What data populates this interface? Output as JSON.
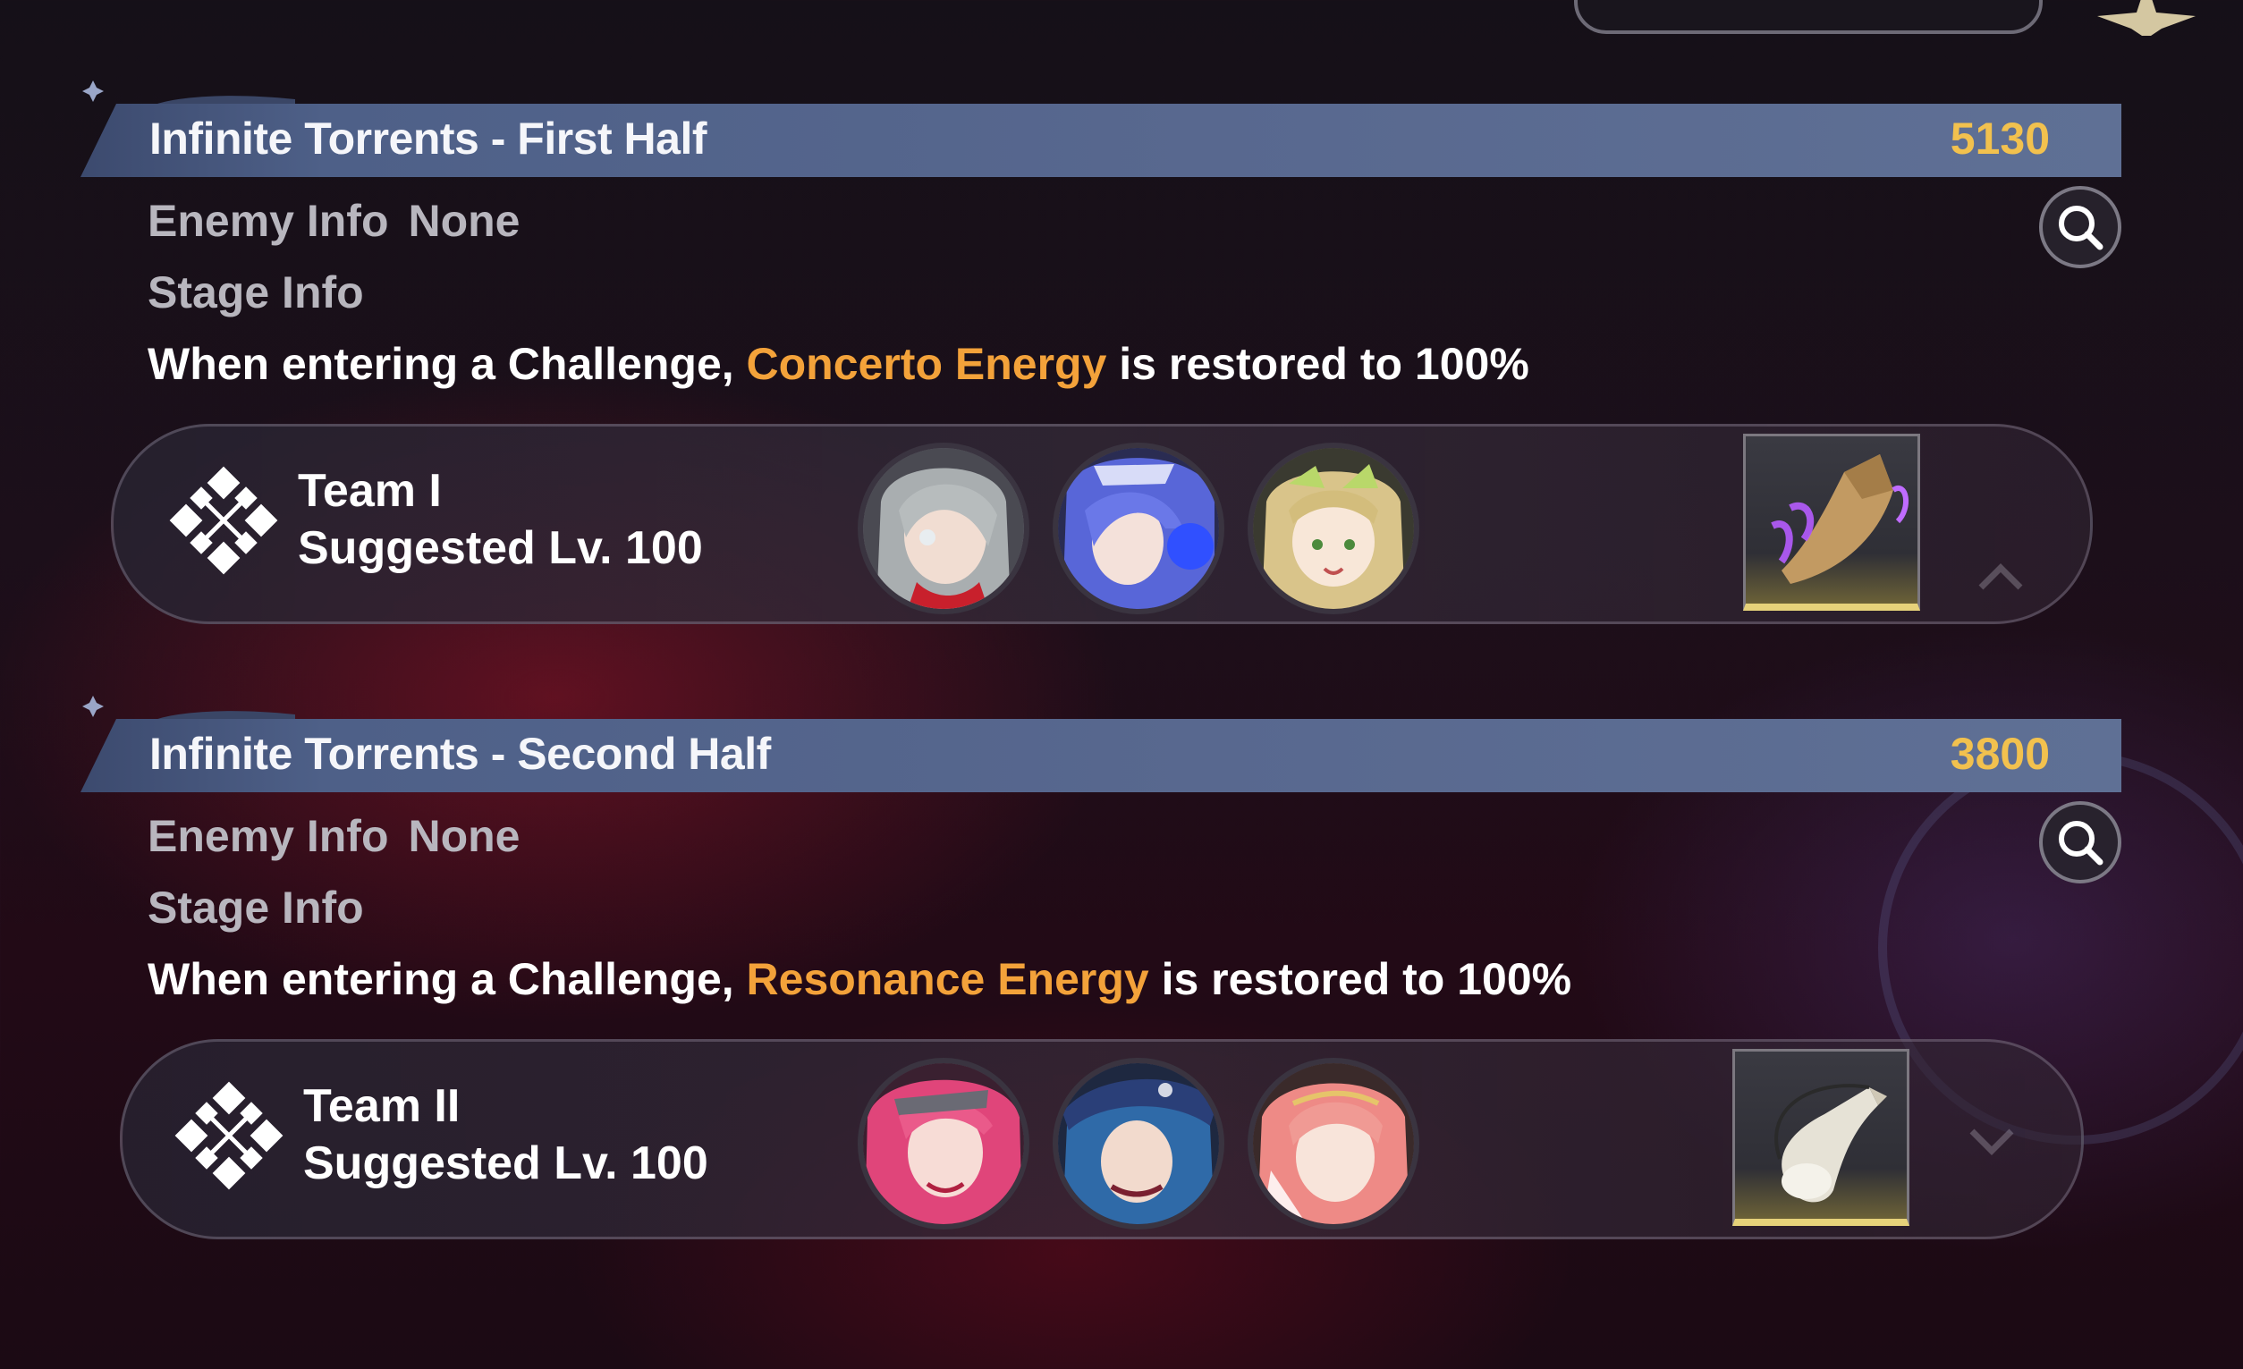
{
  "sections": [
    {
      "title": "Infinite Torrents - First Half",
      "score": "5130",
      "enemy_label": "Enemy Info",
      "enemy_value": "None",
      "stage_label": "Stage Info",
      "desc_prefix": "When entering a Challenge, ",
      "desc_highlight": "Concerto Energy",
      "desc_suffix": " is restored to 100%",
      "team_name": "Team I",
      "team_level": "Suggested Lv. 100",
      "avatars": [
        "gray-haired-character-avatar",
        "blue-haired-character-avatar",
        "blonde-character-avatar"
      ],
      "reward_icon": "glowing-boot-item-icon",
      "toggle_icon": "chevron-up-icon"
    },
    {
      "title": "Infinite Torrents - Second Half",
      "score": "3800",
      "enemy_label": "Enemy Info",
      "enemy_value": "None",
      "stage_label": "Stage Info",
      "desc_prefix": "When entering a Challenge, ",
      "desc_highlight": "Resonance Energy",
      "desc_suffix": " is restored to 100%",
      "team_name": "Team II",
      "team_level": "Suggested Lv. 100",
      "avatars": [
        "pink-haired-character-avatar",
        "blue-hat-character-avatar",
        "coral-haired-character-avatar"
      ],
      "reward_icon": "horn-item-icon",
      "toggle_icon": "chevron-down-icon"
    }
  ],
  "colors": {
    "band": "#58688f",
    "score": "#f2c14e",
    "highlight": "#f3a23a",
    "info_text": "#b8b6be"
  }
}
